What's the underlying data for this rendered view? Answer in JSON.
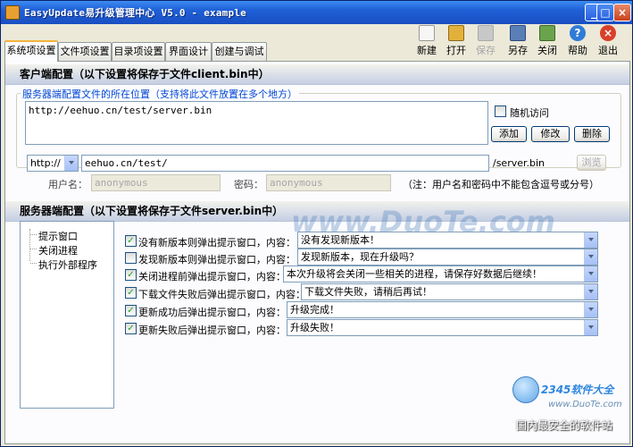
{
  "window": {
    "title": "EasyUpdate易升级管理中心 V5.0 - example"
  },
  "toolbar": {
    "items": [
      {
        "label": "新建",
        "color": "#f0f0f0"
      },
      {
        "label": "打开",
        "color": "#e2b13c"
      },
      {
        "label": "保存",
        "color": "#bdbdbd"
      },
      {
        "label": "另存",
        "color": "#5a7fb7"
      },
      {
        "label": "关闭",
        "color": "#6ba34d"
      },
      {
        "label": "帮助",
        "color": "#2f7bd8"
      },
      {
        "label": "退出",
        "color": "#d9402a"
      }
    ]
  },
  "tabs": [
    "系统项设置",
    "文件项设置",
    "目录项设置",
    "界面设计",
    "创建与调试"
  ],
  "client": {
    "heading": "客户端配置（以下设置将保存于文件client.bin中）",
    "group_caption": "服务器端配置文件的所在位置（支持将此文件放置在多个地方）",
    "url_list": "http://eehuo.cn/test/server.bin",
    "random_access_label": "随机访问",
    "add_label": "添加",
    "modify_label": "修改",
    "delete_label": "删除",
    "protocol": "http://",
    "host_value": "eehuo.cn/test/",
    "file_suffix": "/server.bin",
    "browse_label": "浏览",
    "user_label": "用户名：",
    "user_value": "anonymous",
    "pass_label": "密码：",
    "pass_value": "anonymous",
    "note": "（注：用户名和密码中不能包含逗号或分号）"
  },
  "server": {
    "heading": "服务器端配置（以下设置将保存于文件server.bin中）",
    "tree": [
      "提示窗口",
      "关闭进程",
      "执行外部程序"
    ],
    "rows": [
      {
        "checked": true,
        "label": "没有新版本则弹出提示窗口，内容：",
        "value": "没有发现新版本！"
      },
      {
        "checked": false,
        "label": "发现新版本则弹出提示窗口，内容：",
        "value": "发现新版本，现在升级吗？"
      },
      {
        "checked": true,
        "label": "关闭进程前弹出提示窗口，内容：",
        "value": "本次升级将会关闭一些相关的进程，请保存好数据后继续！"
      },
      {
        "checked": true,
        "label": "下载文件失败后弹出提示窗口，内容：",
        "value": "下载文件失败，请稍后再试！"
      },
      {
        "checked": true,
        "label": "更新成功后弹出提示窗口，内容：",
        "value": "升级完成！"
      },
      {
        "checked": true,
        "label": "更新失败后弹出提示窗口，内容：",
        "value": "升级失败！"
      }
    ]
  },
  "overlay": {
    "watermark": "www.DuoTe.com",
    "brand_logo": "2345软件大全",
    "brand_url": "www.DuoTe.com",
    "brand_slogan": "国内最安全的软件站"
  }
}
